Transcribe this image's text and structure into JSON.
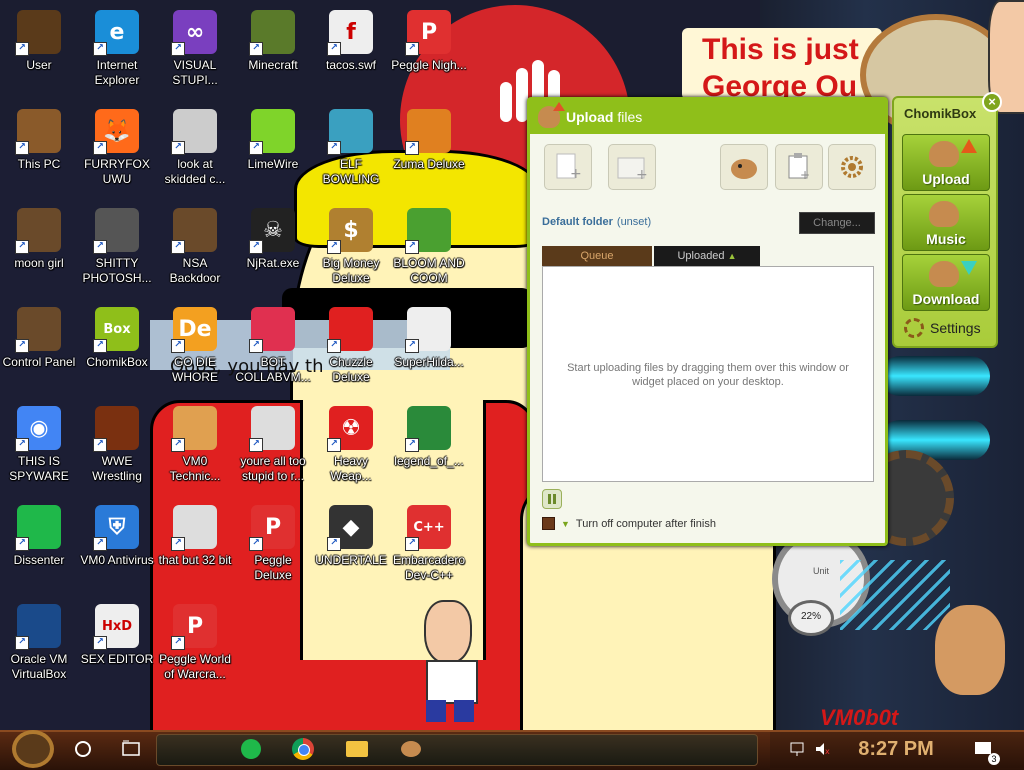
{
  "desktop_icons": [
    {
      "label": "User",
      "icon": "user-folder-icon"
    },
    {
      "label": "Internet Explorer",
      "icon": "edge-icon"
    },
    {
      "label": "VISUAL STUPI...",
      "icon": "visual-studio-icon"
    },
    {
      "label": "Minecraft",
      "icon": "minecraft-icon"
    },
    {
      "label": "tacos.swf",
      "icon": "swf-file-icon"
    },
    {
      "label": "Peggle Nigh...",
      "icon": "peggle-icon"
    },
    {
      "label": "This PC",
      "icon": "computer-icon"
    },
    {
      "label": "FURRYFOX UWU",
      "icon": "firefox-icon"
    },
    {
      "label": "look at skidded c...",
      "icon": "windows-stack-icon"
    },
    {
      "label": "LimeWire",
      "icon": "limewire-icon"
    },
    {
      "label": "ELF BOWLING",
      "icon": "elf-bowling-icon"
    },
    {
      "label": "Zuma Deluxe",
      "icon": "zuma-icon"
    },
    {
      "label": "moon girl",
      "icon": "moon-girl-icon"
    },
    {
      "label": "SHITTY PHOTOSH...",
      "icon": "gimp-icon"
    },
    {
      "label": "NSA Backdoor",
      "icon": "nsa-backdoor-icon"
    },
    {
      "label": "NjRat.exe",
      "icon": "skull-icon"
    },
    {
      "label": "Big Money Deluxe",
      "icon": "money-bag-icon"
    },
    {
      "label": "BLOOM AND COOM",
      "icon": "flower-icon"
    },
    {
      "label": "Control Panel",
      "icon": "control-panel-icon"
    },
    {
      "label": "ChomikBox",
      "icon": "chomikbox-icon"
    },
    {
      "label": "GO DIE WHORE",
      "icon": "de-app-icon"
    },
    {
      "label": "BOT COLLABVM...",
      "icon": "monitor-icon"
    },
    {
      "label": "Chuzzle Deluxe",
      "icon": "chuzzle-icon"
    },
    {
      "label": "SuperHilda...",
      "icon": "pixel-art-icon"
    },
    {
      "label": "THIS IS SPYWARE",
      "icon": "chrome-icon"
    },
    {
      "label": "WWE Wrestling",
      "icon": "wrestling-icon"
    },
    {
      "label": "VM0 Technic...",
      "icon": "support-person-icon"
    },
    {
      "label": "youre all too stupid to r...",
      "icon": "portrait-icon"
    },
    {
      "label": "Heavy Weap...",
      "icon": "radiation-icon"
    },
    {
      "label": "legend_of_...",
      "icon": "zelda-sprite-icon"
    },
    {
      "label": "Dissenter",
      "icon": "dissenter-icon"
    },
    {
      "label": "VM0 Antivirus",
      "icon": "shield-icon"
    },
    {
      "label": "that but 32 bit",
      "icon": "portrait-icon"
    },
    {
      "label": "Peggle Deluxe",
      "icon": "peggle-icon"
    },
    {
      "label": "UNDERTALE",
      "icon": "unity-icon"
    },
    {
      "label": "Embarcadero Dev-C++",
      "icon": "devcpp-icon"
    },
    {
      "label": "Oracle VM VirtualBox",
      "icon": "virtualbox-icon"
    },
    {
      "label": "SEX EDITOR",
      "icon": "hxd-icon"
    },
    {
      "label": "Peggle World of Warcra...",
      "icon": "peggle-icon"
    }
  ],
  "wallpaper": {
    "banner_line1": "This is just",
    "banner_line2": "George Ou",
    "overlay_text": "Oops, you hav th",
    "watermark": "VM0b0t",
    "clock_text": "Unit",
    "gauge_text": "22%"
  },
  "upload_window": {
    "title_bold": "Upload",
    "title_rest": " files",
    "default_folder_label": "Default folder",
    "default_folder_value": "(unset)",
    "change_button": "Change...",
    "tabs": [
      "Queue",
      "Uploaded"
    ],
    "empty_message": "Start uploading files by dragging them over this window or widget placed on your desktop.",
    "turn_off_label": "Turn off computer after finish"
  },
  "chomikbox": {
    "title": "ChomikBox",
    "close": "×",
    "buttons": [
      "Upload",
      "Music",
      "Download"
    ],
    "settings": "Settings"
  },
  "taskbar": {
    "time": "8:27 PM",
    "notification_count": "3"
  },
  "colors": {
    "chomik_green": "#8fbf1a",
    "taskbar_brown": "#3a1a0b"
  }
}
